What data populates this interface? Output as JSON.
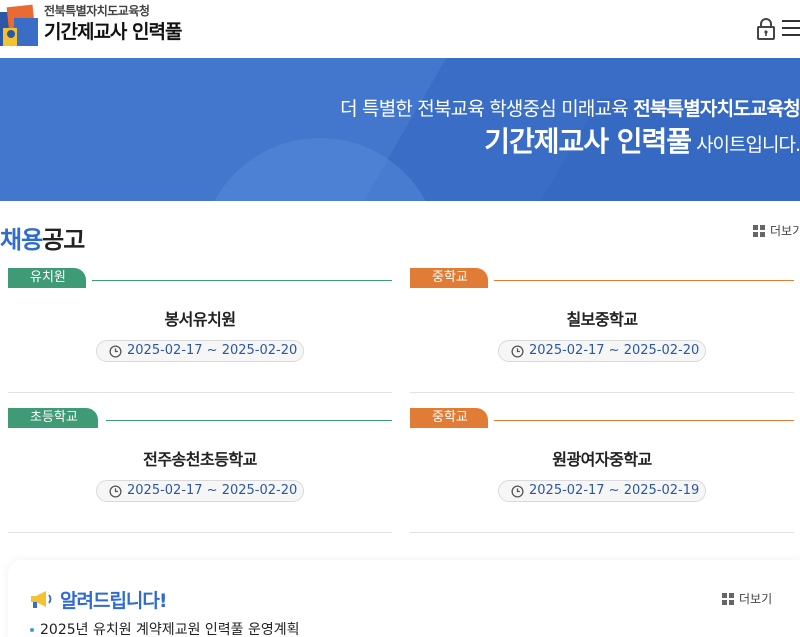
{
  "header": {
    "org_name": "전북특별자치도교육청",
    "site_title": "기간제교사 인력풀"
  },
  "banner": {
    "line1_normal": "더 특별한 전북교육 학생중심 미래교육 ",
    "line1_bold": "전북특별자치도교육청",
    "line2_bold": "기간제교사 인력풀",
    "line2_normal": " 사이트입니다."
  },
  "recruit": {
    "title_highlight": "채용",
    "title_rest": "공고",
    "more_label": "더보기",
    "cards": [
      {
        "category": "유치원",
        "school": "봉서유치원",
        "period": "2025-02-17 ~ 2025-02-20",
        "color": "#3f9a76"
      },
      {
        "category": "중학교",
        "school": "칠보중학교",
        "period": "2025-02-17 ~ 2025-02-20",
        "color": "#e07c36"
      },
      {
        "category": "초등학교",
        "school": "전주송천초등학교",
        "period": "2025-02-17 ~ 2025-02-20",
        "color": "#3f9a76"
      },
      {
        "category": "중학교",
        "school": "원광여자중학교",
        "period": "2025-02-17 ~ 2025-02-19",
        "color": "#e07c36"
      }
    ]
  },
  "notice": {
    "title": "알려드립니다!",
    "more_label": "더보기",
    "items": [
      {
        "text": "2025년 유치원 계약제교원 인력풀 운영계획"
      }
    ]
  },
  "colors": {
    "brand_blue": "#2f6bd0",
    "banner_blue": "#3a6ec6",
    "green": "#3f9a76",
    "orange": "#e07c36"
  },
  "icons": [
    "logo-mark",
    "lock-icon",
    "hamburger-menu-icon",
    "grid-icon",
    "clock-icon",
    "megaphone-icon"
  ]
}
